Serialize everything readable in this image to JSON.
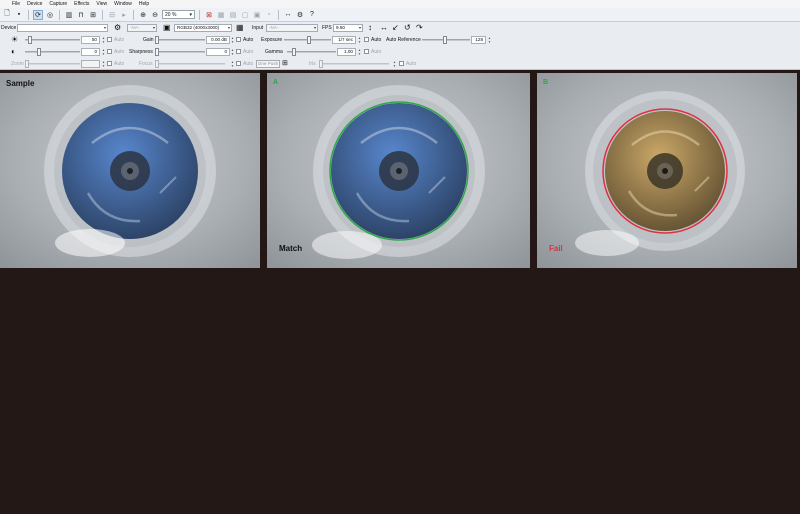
{
  "menu": [
    "File",
    "Device",
    "Capture",
    "Effects",
    "View",
    "Window",
    "Help"
  ],
  "toolbar": {
    "zoom_value": "20 %"
  },
  "controls": {
    "device_label": "Device",
    "device_value": "",
    "resolution_value": "-NA-",
    "format_value": "RGB32 (4000x3000)",
    "input_label": "Input",
    "input_value": "-NA-",
    "fps_label": "FPS",
    "fps_value": "9.50",
    "brightness_value": "50",
    "contrast_value": "0",
    "gain_label": "Gain",
    "gain_value": "0.00 dB",
    "sharpness_label": "Sharpness",
    "sharpness_value": "0",
    "exposure_label": "Exposure",
    "exposure_value": "1/7 sec",
    "gamma_label": "Gamma",
    "gamma_value": "1.00",
    "auto_reference_label": "Auto Reference",
    "auto_reference_value": "128",
    "zoom_label": "Zoom",
    "focus_label": "Focus",
    "iris_label": "Iris",
    "one_push_label": "One Push",
    "auto_label": "Auto"
  },
  "views": [
    {
      "label": "Sample",
      "result": "",
      "cap_color": "#3d5d8e",
      "ring": ""
    },
    {
      "label": "A",
      "result": "Match",
      "cap_color": "#3d5d8e",
      "ring": "#2ea84a"
    },
    {
      "label": "B",
      "result": "Fail",
      "cap_color": "#8c7448",
      "ring": "#e03040"
    }
  ],
  "icons": {
    "toolbar": [
      "new-file-icon",
      "save-icon",
      "capture-icon",
      "snapshot-icon",
      "histogram-icon",
      "waveform-icon",
      "usb-icon",
      "record-icon",
      "play-icon",
      "zoom-in-icon",
      "zoom-out-icon",
      "crosshair-icon",
      "grid-icon",
      "layout-icon",
      "measure-icon",
      "tools-icon",
      "help-icon"
    ],
    "brightness": "sun-icon",
    "contrast": "contrast-icon"
  }
}
